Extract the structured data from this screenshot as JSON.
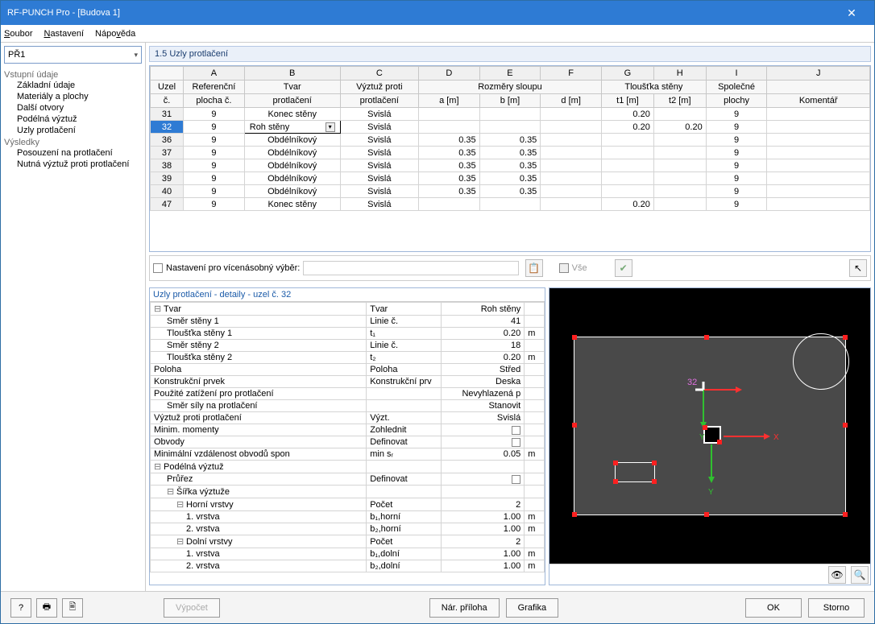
{
  "window": {
    "title": "RF-PUNCH Pro  - [Budova 1]"
  },
  "menu": {
    "file": "Soubor",
    "settings": "Nastavení",
    "help": "Nápověda"
  },
  "sidebar": {
    "combo": "PŘ1",
    "cat_input": "Vstupní údaje",
    "items_input": [
      "Základní údaje",
      "Materiály a plochy",
      "Další otvory",
      "Podélná výztuž",
      "Uzly protlačení"
    ],
    "cat_results": "Výsledky",
    "items_results": [
      "Posouzení na protlačení",
      "Nutná výztuž proti protlačení"
    ]
  },
  "section": {
    "title": "1.5 Uzly protlačení"
  },
  "table": {
    "cols_letters": [
      "A",
      "B",
      "C",
      "D",
      "E",
      "F",
      "G",
      "H",
      "I",
      "J"
    ],
    "header1": {
      "uzel": "Uzel",
      "ref": "Referenční",
      "tvar": "Tvar",
      "vyztuz": "Výztuž proti",
      "rozmery": "Rozměry sloupu",
      "tloustka": "Tloušťka stěny",
      "spolecne": "Společné",
      "komentar": ""
    },
    "header2": {
      "c": "č.",
      "plocha": "plocha č.",
      "protlaceni": "protlačení",
      "protlaceni2": "protlačení",
      "a": "a [m]",
      "b": "b [m]",
      "d": "d [m]",
      "t1": "t1 [m]",
      "t2": "t2 [m]",
      "plochy": "plochy",
      "komentar": "Komentář"
    },
    "rows": [
      {
        "n": "31",
        "ref": "9",
        "tvar": "Konec stěny",
        "vyz": "Svislá",
        "a": "",
        "b": "",
        "d": "",
        "t1": "0.20",
        "t2": "",
        "sp": "9"
      },
      {
        "n": "32",
        "ref": "9",
        "tvar": "Roh stěny",
        "vyz": "Svislá",
        "a": "",
        "b": "",
        "d": "",
        "t1": "0.20",
        "t2": "0.20",
        "sp": "9",
        "sel": true
      },
      {
        "n": "36",
        "ref": "9",
        "tvar": "Obdélníkový",
        "vyz": "Svislá",
        "a": "0.35",
        "b": "0.35",
        "d": "",
        "t1": "",
        "t2": "",
        "sp": "9"
      },
      {
        "n": "37",
        "ref": "9",
        "tvar": "Obdélníkový",
        "vyz": "Svislá",
        "a": "0.35",
        "b": "0.35",
        "d": "",
        "t1": "",
        "t2": "",
        "sp": "9"
      },
      {
        "n": "38",
        "ref": "9",
        "tvar": "Obdélníkový",
        "vyz": "Svislá",
        "a": "0.35",
        "b": "0.35",
        "d": "",
        "t1": "",
        "t2": "",
        "sp": "9"
      },
      {
        "n": "39",
        "ref": "9",
        "tvar": "Obdélníkový",
        "vyz": "Svislá",
        "a": "0.35",
        "b": "0.35",
        "d": "",
        "t1": "",
        "t2": "",
        "sp": "9"
      },
      {
        "n": "40",
        "ref": "9",
        "tvar": "Obdélníkový",
        "vyz": "Svislá",
        "a": "0.35",
        "b": "0.35",
        "d": "",
        "t1": "",
        "t2": "",
        "sp": "9"
      },
      {
        "n": "47",
        "ref": "9",
        "tvar": "Konec stěny",
        "vyz": "Svislá",
        "a": "",
        "b": "",
        "d": "",
        "t1": "0.20",
        "t2": "",
        "sp": "9"
      }
    ]
  },
  "multibox": {
    "label": "Nastavení pro vícenásobný výběr:",
    "all": "Vše"
  },
  "details": {
    "title": "Uzly protlačení - detaily - uzel č. 32",
    "rows": [
      {
        "t": "group",
        "lbl": "Tvar",
        "c2": "Tvar",
        "c3": "Roh stěny"
      },
      {
        "t": "ind1",
        "lbl": "Směr stěny 1",
        "c2": "Linie č.",
        "c3": "41"
      },
      {
        "t": "ind1",
        "lbl": "Tloušťka stěny 1",
        "c2": "t₁",
        "c3": "0.20",
        "u": "m"
      },
      {
        "t": "ind1",
        "lbl": "Směr stěny 2",
        "c2": "Linie č.",
        "c3": "18"
      },
      {
        "t": "ind1",
        "lbl": "Tloušťka stěny 2",
        "c2": "t₂",
        "c3": "0.20",
        "u": "m"
      },
      {
        "t": "plain",
        "lbl": "Poloha",
        "c2": "Poloha",
        "c3": "Střed"
      },
      {
        "t": "plain",
        "lbl": "Konstrukční prvek",
        "c2": "Konstrukční prv",
        "c3": "Deska"
      },
      {
        "t": "plain",
        "lbl": "Použité zatížení pro protlačení",
        "c2": "",
        "c3": "Nevyhlazená p"
      },
      {
        "t": "ind1",
        "lbl": "Směr síly na protlačení",
        "c2": "",
        "c3": "Stanovit"
      },
      {
        "t": "plain",
        "lbl": "Výztuž proti protlačení",
        "c2": "Výzt.",
        "c3": "Svislá"
      },
      {
        "t": "plain",
        "lbl": "Minim. momenty",
        "c2": "Zohlednit",
        "c3": "",
        "box": true
      },
      {
        "t": "plain",
        "lbl": "Obvody",
        "c2": "Definovat",
        "c3": "",
        "box": true
      },
      {
        "t": "plain",
        "lbl": "Minimální vzdálenost obvodů spon",
        "c2": "min sᵣ",
        "c3": "0.05",
        "u": "m"
      },
      {
        "t": "group",
        "lbl": "Podélná výztuž"
      },
      {
        "t": "ind1",
        "lbl": "Průřez",
        "c2": "Definovat",
        "c3": "",
        "box": true
      },
      {
        "t": "group1",
        "lbl": "Šířka výztuže"
      },
      {
        "t": "group2",
        "lbl": "Horní vrstvy",
        "c2": "Počet",
        "c3": "2"
      },
      {
        "t": "ind3",
        "lbl": "1. vrstva",
        "c2": "b₁,horní",
        "c3": "1.00",
        "u": "m"
      },
      {
        "t": "ind3",
        "lbl": "2. vrstva",
        "c2": "b₂,horní",
        "c3": "1.00",
        "u": "m"
      },
      {
        "t": "group2",
        "lbl": "Dolní vrstvy",
        "c2": "Počet",
        "c3": "2"
      },
      {
        "t": "ind3",
        "lbl": "1. vrstva",
        "c2": "b₁,dolní",
        "c3": "1.00",
        "u": "m"
      },
      {
        "t": "ind3",
        "lbl": "2. vrstva",
        "c2": "b₂,dolní",
        "c3": "1.00",
        "u": "m"
      }
    ]
  },
  "preview": {
    "node_label": "32",
    "axis_x": "X",
    "axis_y": "Y"
  },
  "footer": {
    "vypocet": "Výpočet",
    "nar": "Nár. příloha",
    "grafika": "Grafika",
    "ok": "OK",
    "storno": "Storno"
  }
}
